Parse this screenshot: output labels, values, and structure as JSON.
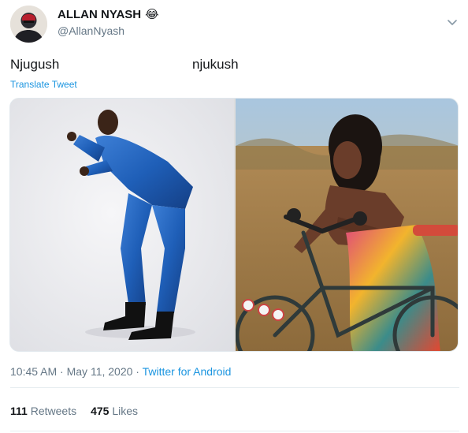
{
  "user": {
    "display_name": "ALLAN NYASH",
    "emoji": "😂",
    "handle": "@AllanNyash"
  },
  "tweet": {
    "text_left": "Njugush",
    "text_right": "njukush",
    "translate_label": "Translate Tweet"
  },
  "meta": {
    "time": "10:45 AM",
    "separator": "·",
    "date": "May 11, 2020",
    "source": "Twitter for Android"
  },
  "stats": {
    "retweets_count": "111",
    "retweets_label": "Retweets",
    "likes_count": "475",
    "likes_label": "Likes"
  },
  "icons": {
    "menu": "chevron-down-icon"
  },
  "colors": {
    "link": "#1b95e0",
    "secondary_text": "#657786",
    "primary_text": "#14171a"
  }
}
